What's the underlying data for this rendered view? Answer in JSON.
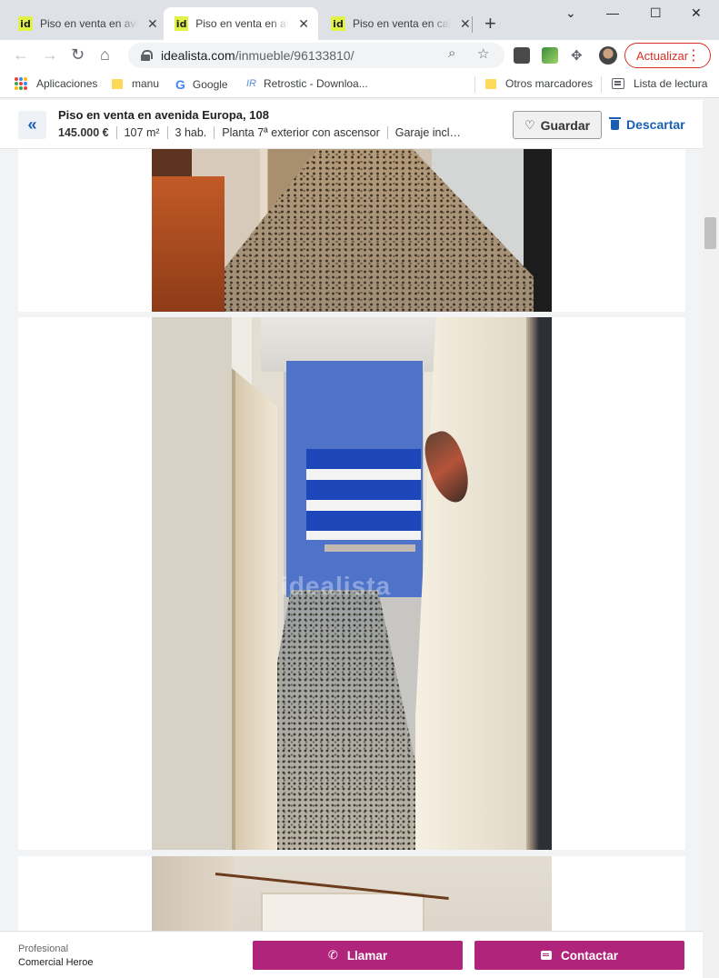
{
  "browser": {
    "tabs": [
      {
        "favicon": "id",
        "title": "Piso en venta en avenida Europa"
      },
      {
        "favicon": "id",
        "title": "Piso en venta en avenida Europa"
      },
      {
        "favicon": "id",
        "title": "Piso en venta en calle"
      }
    ],
    "url_host": "idealista.com",
    "url_path": "/inmueble/96133810/",
    "update_label": "Actualizar",
    "bookmarks": [
      {
        "label": "Aplicaciones",
        "icon": "apps-grid-icon"
      },
      {
        "label": "manu",
        "icon": "folder-icon"
      },
      {
        "label": "Google",
        "icon": "google-icon"
      },
      {
        "label": "Retrostic - Downloa...",
        "icon": "retrostic-icon"
      }
    ],
    "other_bookmarks": "Otros marcadores",
    "reading_list": "Lista de lectura"
  },
  "listing": {
    "title": "Piso en venta en avenida Europa, 108",
    "price": "145.000 €",
    "area": "107 m²",
    "rooms": "3 hab.",
    "floor": "Planta 7ª exterior con ascensor",
    "garage": "Garaje incluido en el precio",
    "save_label": "Guardar",
    "discard_label": "Descartar",
    "watermark": "idealista"
  },
  "contact": {
    "pro_label": "Profesional",
    "agency": "Comercial Heroe",
    "call_label": "Llamar",
    "contact_label": "Contactar"
  },
  "colors": {
    "accent": "#b0247c",
    "link": "#1a5fb4",
    "update": "#d93025"
  }
}
